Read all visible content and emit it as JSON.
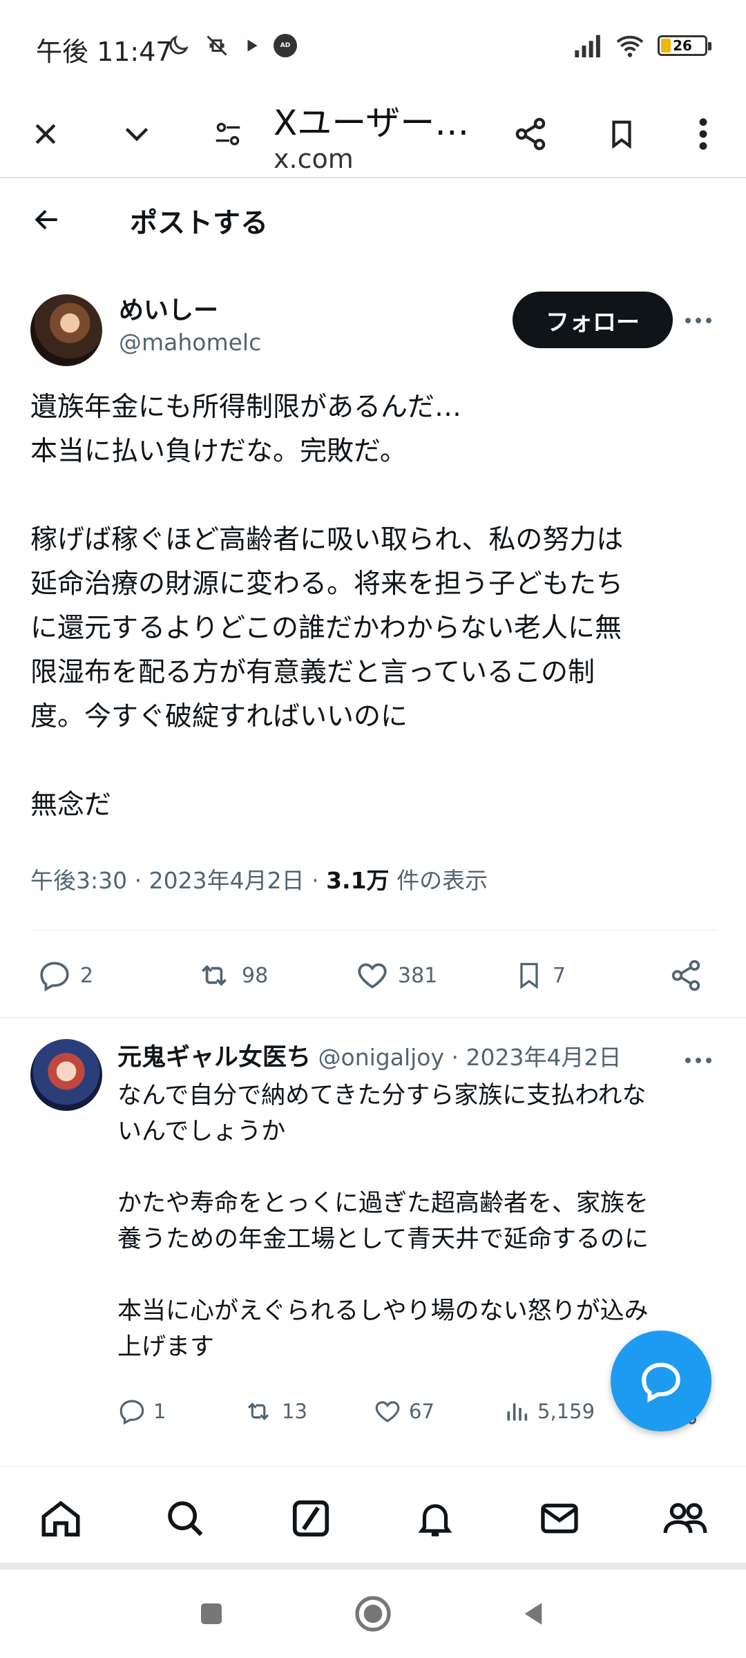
{
  "status_bar": {
    "time": "午後 11:47",
    "battery_level": "26"
  },
  "toolbar": {
    "title": "Xユーザー…",
    "url": "x.com"
  },
  "header": {
    "title": "ポストする"
  },
  "post": {
    "author_name": "めいしー",
    "author_handle": "@mahomelc",
    "follow_label": "フォロー",
    "text": "遺族年金にも所得制限があるんだ…\n本当に払い負けだな。完敗だ。\n\n稼げば稼ぐほど高齢者に吸い取られ、私の努力は\n延命治療の財源に変わる。将来を担う子どもたち\nに還元するよりどこの誰だかわからない老人に無\n限湿布を配る方が有意義だと言っているこの制\n度。今すぐ破綻すればいいのに\n\n無念だ",
    "time": "午後3:30",
    "date": "2023年4月2日",
    "views_count": "3.1万",
    "views_label": "件の表示",
    "sep": "·",
    "stats": {
      "replies": "2",
      "reposts": "98",
      "likes": "381",
      "bookmarks": "7"
    }
  },
  "reply": {
    "author_name": "元鬼ギャル女医ち",
    "author_handle": "@onigaljoy",
    "sep": "·",
    "date": "2023年4月2日",
    "text": "なんで自分で納めてきた分すら家族に支払われな\nいんでしょうか\n\nかたや寿命をとっくに過ぎた超高齢者を、家族を\n養うための年金工場として青天井で延命するのに\n\n本当に心がえぐられるしやり場のない怒りが込み\n上げます",
    "stats": {
      "replies": "1",
      "reposts": "13",
      "likes": "67",
      "views": "5,159"
    }
  },
  "colors": {
    "accent": "#1d9bf0",
    "text": "#0f1419",
    "muted": "#536471"
  }
}
